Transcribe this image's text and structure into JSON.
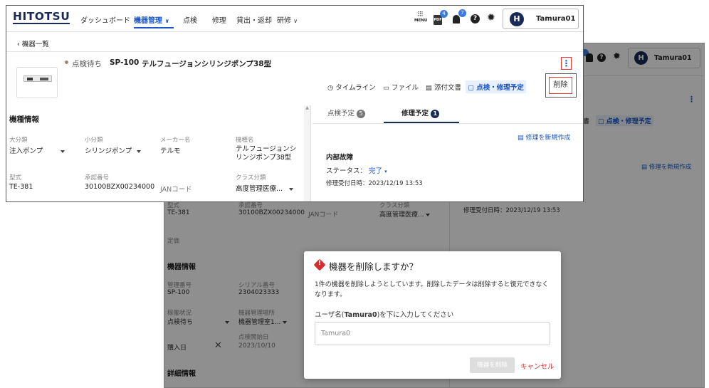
{
  "brand": "HITOTSU",
  "nav": {
    "items": [
      "ダッシュボード",
      "機器管理",
      "点検",
      "修理",
      "貸出・返却",
      "研修"
    ],
    "menu_label": "MENU",
    "pdf_badge": "4",
    "bell_badge": "7",
    "user_initial": "H",
    "user_name": "Tamura01"
  },
  "back_link": "機器一覧",
  "device": {
    "status": "点検待ち",
    "code": "SP-100",
    "name": "テルフュージョンシリンジポンプ38型"
  },
  "menu_delete": "削除",
  "right_tabs": [
    "タイムライン",
    "ファイル",
    "添付文書",
    "点検・修理予定"
  ],
  "sub_tabs": {
    "inspection": {
      "label": "点検予定",
      "count": "5"
    },
    "repair": {
      "label": "修理予定",
      "count": "1"
    }
  },
  "repair": {
    "new_link": "修理を新規作成",
    "title": "内部故障",
    "status_label": "ステータス：",
    "status_value": "完了",
    "received": "修理受付日時：2023/12/19 13:53"
  },
  "machine_info": {
    "section": "機種情報",
    "labels": [
      "大分類",
      "小分類",
      "メーカー名",
      "機種名"
    ],
    "values": [
      "注入ポンプ",
      "シリンジポンプ",
      "テルモ",
      "テルフュージョンシリンジポンプ38型"
    ],
    "labels2": [
      "型式",
      "承認番号",
      "",
      "クラス分類"
    ],
    "values2": [
      "TE-381",
      "30100BZX00234000",
      "JANコード",
      "高度管理医療..."
    ]
  },
  "background": {
    "model_label": "型式",
    "model_value": "TE-381",
    "approval_label": "承認番号",
    "approval_value": "30100BZX00234000",
    "jan_value": "JANコード",
    "class_label": "クラス分類",
    "class_value": "高度管理医療...",
    "price_label": "定価",
    "equipment_section": "機器情報",
    "mgmt_label": "管理番号",
    "mgmt_value": "SP-100",
    "serial_label": "シリアル番号",
    "serial_value": "2304023333",
    "move_label": "稼働状況",
    "move_value": "点検待ち",
    "place_label": "機器管理場所",
    "place_value": "機器管理室1...",
    "purchase_label": "購入日",
    "inspect_start_label": "点検開始日",
    "inspect_start_value": "2023/10/10",
    "detail_section": "詳細情報",
    "tab_fragment": "書",
    "tab_schedule": "点検・修理予定",
    "new_repair": "修理を新規作成",
    "received": "修理受付日時：2023/12/19 13:53",
    "user_name": "Tamura01",
    "user_initial": "H"
  },
  "dialog": {
    "title": "機器を削除しますか？",
    "body": "1件の機器を削除しようとしています。削除したデータは削除すると復元できなくなります。",
    "prompt_pre": "ユーザ名(",
    "prompt_bold": "Tamura0",
    "prompt_post": ")を下に入力してください",
    "input_value": "Tamura0",
    "delete_button": "機器を削除",
    "cancel_button": "キャンセル"
  },
  "colors": {
    "brand_navy": "#1a2a57",
    "accent_blue": "#1a56c8",
    "danger_red": "#e53935",
    "status_dot": "#9c8b6a"
  }
}
